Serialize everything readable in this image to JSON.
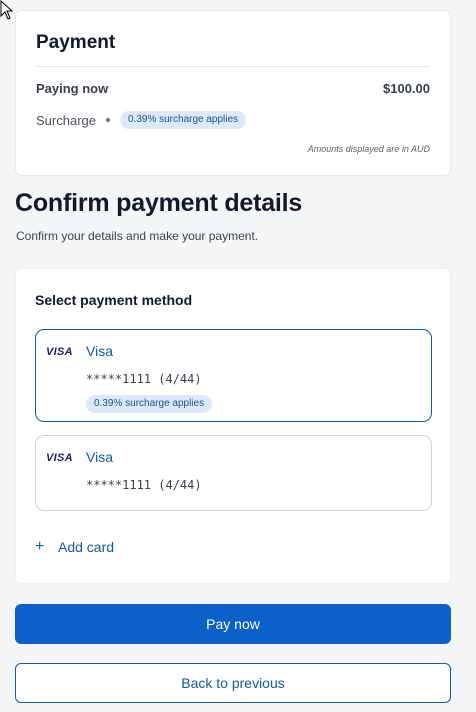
{
  "summary": {
    "title": "Payment",
    "paying_now_label": "Paying now",
    "paying_now_value": "$100.00",
    "surcharge_label": "Surcharge",
    "surcharge_badge": "0.39% surcharge applies",
    "currency_note": "Amounts displayed are in AUD"
  },
  "confirm": {
    "heading": "Confirm payment details",
    "subheading": "Confirm your details and make your payment."
  },
  "methods": {
    "title": "Select payment method",
    "items": [
      {
        "brand_logo": "VISA",
        "name": "Visa",
        "masked_number": "*****1111 (4/44)",
        "badge": "0.39% surcharge applies",
        "selected": true
      },
      {
        "brand_logo": "VISA",
        "name": "Visa",
        "masked_number": "*****1111 (4/44)",
        "selected": false
      }
    ],
    "add_card_label": "Add card"
  },
  "actions": {
    "pay_label": "Pay now",
    "back_label": "Back to previous"
  },
  "colors": {
    "accent": "#0b61c9",
    "link": "#0b5cab",
    "badge_bg": "#dbe9fb"
  },
  "icons": {
    "cursor": "mouse-pointer-icon",
    "add": "plus-icon"
  }
}
